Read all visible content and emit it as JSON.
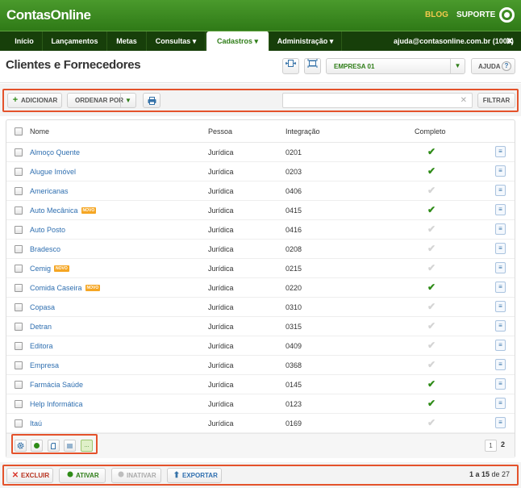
{
  "app": {
    "logo": "ContasOnline",
    "blog": "BLOG",
    "suporte": "SUPORTE"
  },
  "nav": {
    "items": [
      {
        "label": "Início"
      },
      {
        "label": "Lançamentos"
      },
      {
        "label": "Metas"
      },
      {
        "label": "Consultas ▾"
      },
      {
        "label": "Cadastros ▾"
      },
      {
        "label": "Administração ▾"
      }
    ],
    "user": "ajuda@contasonline.com.br (1000)",
    "close": "✕"
  },
  "header": {
    "title": "Clientes e Fornecedores",
    "company": "EMPRESA 01",
    "help": "AJUDA",
    "help_icon": "?"
  },
  "toolbar": {
    "add": "ADICIONAR",
    "order": "ORDENAR POR",
    "filter": "FILTRAR",
    "search_value": ""
  },
  "table": {
    "columns": {
      "name": "Nome",
      "person": "Pessoa",
      "integration": "Integração",
      "complete": "Completo"
    },
    "novo_label": "NOVO",
    "rows": [
      {
        "name": "Almoço Quente",
        "person": "Jurídica",
        "integration": "0201",
        "complete": true,
        "novo": false
      },
      {
        "name": "Alugue Imóvel",
        "person": "Jurídica",
        "integration": "0203",
        "complete": true,
        "novo": false
      },
      {
        "name": "Americanas",
        "person": "Jurídica",
        "integration": "0406",
        "complete": false,
        "novo": false
      },
      {
        "name": "Auto Mecânica",
        "person": "Jurídica",
        "integration": "0415",
        "complete": true,
        "novo": true
      },
      {
        "name": "Auto Posto",
        "person": "Jurídica",
        "integration": "0416",
        "complete": false,
        "novo": false
      },
      {
        "name": "Bradesco",
        "person": "Jurídica",
        "integration": "0208",
        "complete": false,
        "novo": false
      },
      {
        "name": "Cemig",
        "person": "Jurídica",
        "integration": "0215",
        "complete": false,
        "novo": true
      },
      {
        "name": "Comida Caseira",
        "person": "Jurídica",
        "integration": "0220",
        "complete": true,
        "novo": true
      },
      {
        "name": "Copasa",
        "person": "Jurídica",
        "integration": "0310",
        "complete": false,
        "novo": false
      },
      {
        "name": "Detran",
        "person": "Jurídica",
        "integration": "0315",
        "complete": false,
        "novo": false
      },
      {
        "name": "Editora",
        "person": "Jurídica",
        "integration": "0409",
        "complete": false,
        "novo": false
      },
      {
        "name": "Empresa",
        "person": "Jurídica",
        "integration": "0368",
        "complete": false,
        "novo": false
      },
      {
        "name": "Farmácia Saúde",
        "person": "Jurídica",
        "integration": "0145",
        "complete": true,
        "novo": false
      },
      {
        "name": "Help Informática",
        "person": "Jurídica",
        "integration": "0123",
        "complete": true,
        "novo": false
      },
      {
        "name": "Itaú",
        "person": "Jurídica",
        "integration": "0169",
        "complete": false,
        "novo": false
      }
    ]
  },
  "footer": {
    "view_more": "...",
    "pages": [
      "1",
      "2"
    ]
  },
  "bottom": {
    "delete": "EXCLUIR",
    "activate": "ATIVAR",
    "deactivate": "INATIVAR",
    "export": "EXPORTAR",
    "count_prefix": "1 a 15",
    "count_suffix": " de 27"
  },
  "colors": {
    "brand_green": "#2e7d17",
    "nav_dark": "#173f0a",
    "highlight_red": "#e4522b",
    "link_blue": "#2f6fb0",
    "accent_yellow": "#f2c94c"
  }
}
